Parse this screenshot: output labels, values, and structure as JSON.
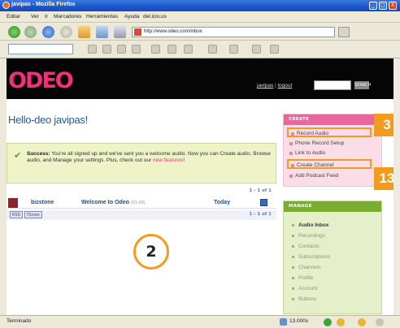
{
  "window": {
    "title": "javipas - Mozilla Firefox"
  },
  "window_buttons": [
    "_",
    "□",
    "X"
  ],
  "menu": [
    "Editar",
    "Ver",
    "Ir",
    "Marcadores",
    "Herramientas",
    "Ayuda",
    "del.icio.us"
  ],
  "nav": {
    "url": "http://www.odeo.com/inbox"
  },
  "header": {
    "logo": "ODEO",
    "user_link": "javipas",
    "separator": "|",
    "logout_link": "logout",
    "search_button": "SEARCH"
  },
  "main": {
    "greeting": "Hello-deo javipas!",
    "success_title": "Success:",
    "success_text": "You're all signed up and we've sent you a welcome audio. Now you can Create audio, Browse audio, and Manage your settings. Plus, check out our",
    "success_link": "new features",
    "success_end": "!",
    "pager": "1 - 1 of 1",
    "inbox_rows": [
      {
        "sender": "bizstone",
        "subject": "Welcome to Odeo",
        "time": "(01:09)",
        "when": "Today"
      }
    ],
    "footer_buttons": [
      "RSS",
      "iTunes"
    ]
  },
  "sidebar": {
    "create_title": "CREATE",
    "create_items": [
      "Record Audio",
      "Phone Record Setup",
      "Link to Audio",
      "Create Channel",
      "Add Podcast Feed"
    ],
    "manage_title": "MANAGE",
    "manage_items": [
      "Audio Inbox",
      "Recordings",
      "Contacts",
      "Subscriptions",
      "Channels",
      "Profile",
      "Account",
      "Buttons"
    ]
  },
  "callouts": {
    "one": "3",
    "two": "13",
    "three": "2"
  },
  "status": {
    "text": "Terminado",
    "value": "13.000s"
  },
  "colors": {
    "brand_pink": "#f0307a",
    "callout_orange": "#f29b1f",
    "create_pink": "#e9679b",
    "manage_green": "#7aad32"
  },
  "icons": [
    "firefox-icon",
    "back-icon",
    "forward-icon",
    "reload-icon",
    "stop-icon",
    "home-icon",
    "bookmark-icon",
    "play-icon"
  ]
}
